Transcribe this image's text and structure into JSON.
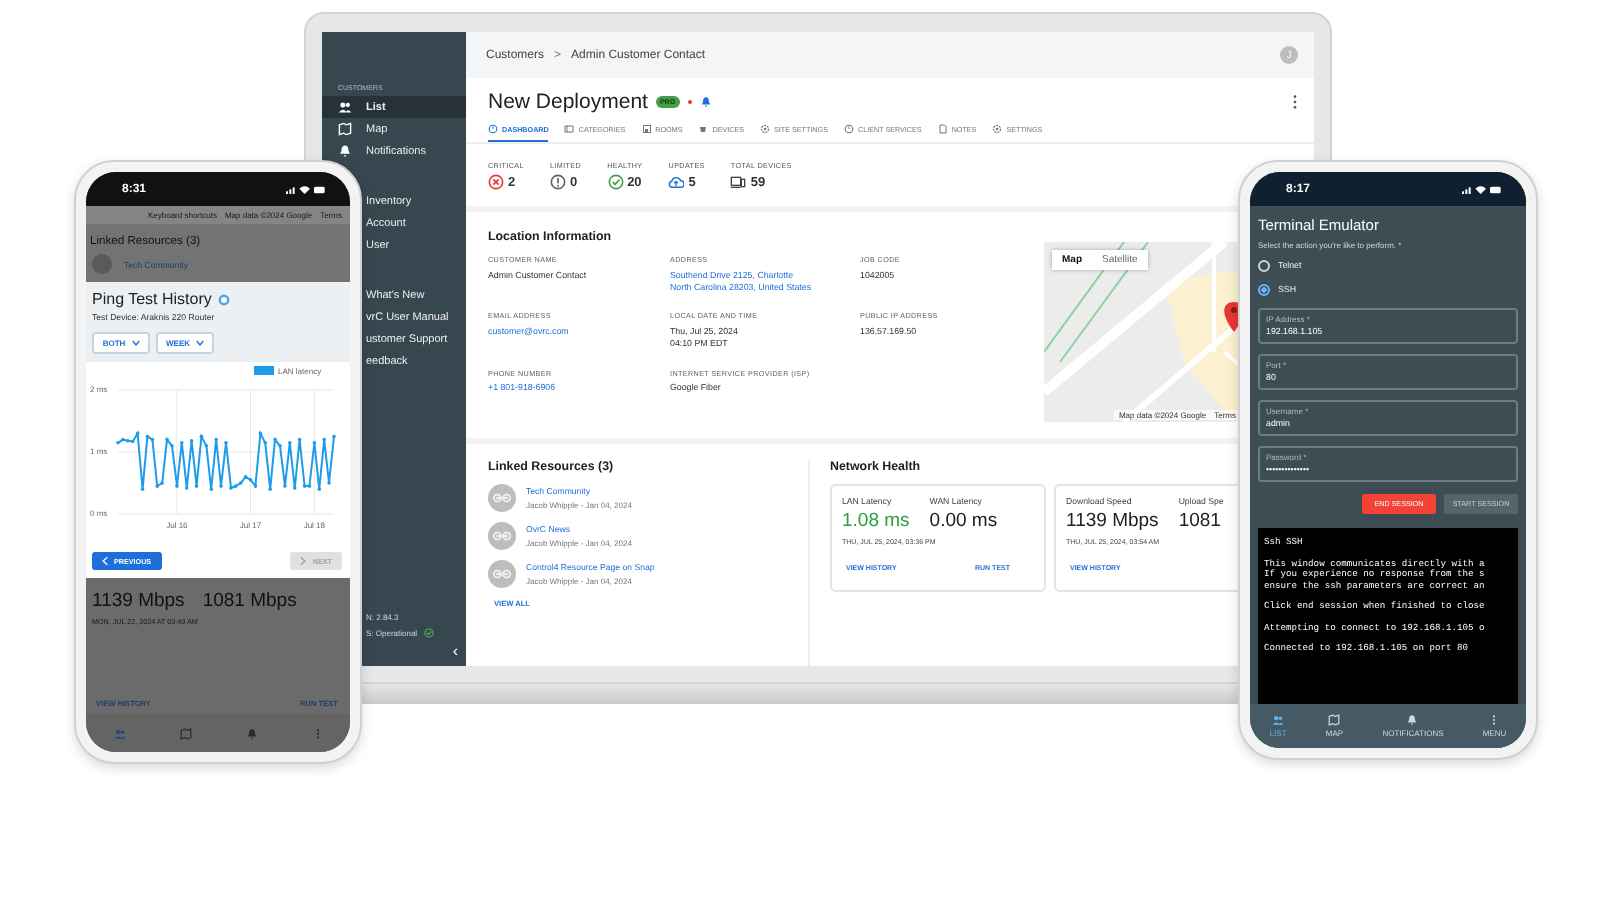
{
  "laptop": {
    "sidebar": {
      "groups": [
        {
          "label": "CUSTOMERS",
          "items": [
            {
              "label": "List",
              "selected": true
            },
            {
              "label": "Map",
              "selected": false
            },
            {
              "label": "Notifications",
              "selected": false
            }
          ]
        },
        {
          "items": [
            {
              "label": "Inventory",
              "selected": false
            },
            {
              "label": "Account",
              "selected": false
            },
            {
              "label": "User",
              "selected": false
            }
          ]
        },
        {
          "items": [
            {
              "label": "What's New",
              "selected": false
            },
            {
              "label": "vrC User Manual",
              "selected": false
            },
            {
              "label": "ustomer Support",
              "selected": false
            },
            {
              "label": "eedback",
              "selected": false
            }
          ]
        }
      ],
      "version": "N: 2.84.3",
      "status": "S: Operational",
      "collapse": "‹"
    },
    "breadcrumbs": [
      "Customers",
      "Admin Customer Contact"
    ],
    "breadcrumb_separator": ">",
    "avatar": "J",
    "title": "New Deployment",
    "badge": "PRO",
    "alert_dot": true,
    "tabs": [
      {
        "label": "DASHBOARD",
        "selected": true
      },
      {
        "label": "CATEGORIES",
        "selected": false
      },
      {
        "label": "ROOMS",
        "selected": false
      },
      {
        "label": "DEVICES",
        "selected": false
      },
      {
        "label": "SITE SETTINGS",
        "selected": false
      },
      {
        "label": "CLIENT SERVICES",
        "selected": false
      },
      {
        "label": "NOTES",
        "selected": false
      },
      {
        "label": "SETTINGS",
        "selected": false
      }
    ],
    "stats": [
      {
        "kind": "critical",
        "label": "CRITICAL",
        "value": "2"
      },
      {
        "kind": "limited",
        "label": "LIMITED",
        "value": "0"
      },
      {
        "kind": "healthy",
        "label": "HEALTHY",
        "value": "20"
      },
      {
        "kind": "updates",
        "label": "UPDATES",
        "value": "5"
      },
      {
        "kind": "total",
        "label": "TOTAL DEVICES",
        "value": "59"
      }
    ],
    "location": {
      "title": "Location Information",
      "fields": [
        {
          "label": "CUSTOMER NAME",
          "lines": [
            "Admin Customer Contact"
          ],
          "link": false
        },
        {
          "label": "ADDRESS",
          "lines": [
            "Southend Drive 2125, Charlotte",
            "North Carolina 28203, United States"
          ],
          "link": true
        },
        {
          "label": "JOB CODE",
          "lines": [
            "1042005"
          ],
          "link": false
        },
        {
          "label": "EMAIL ADDRESS",
          "lines": [
            "customer@ovrc.com"
          ],
          "link": true
        },
        {
          "label": "LOCAL DATE AND TIME",
          "lines": [
            "Thu, Jul 25, 2024",
            "04:10 PM EDT"
          ],
          "link": false
        },
        {
          "label": "PUBLIC IP ADDRESS",
          "lines": [
            "136.57.169.50"
          ],
          "link": false
        },
        {
          "label": "PHONE NUMBER",
          "lines": [
            "+1 801-918-6906"
          ],
          "link": true
        },
        {
          "label": "INTERNET SERVICE PROVIDER (ISP)",
          "lines": [
            "Google Fiber"
          ],
          "link": false
        }
      ],
      "map": {
        "toggles": [
          {
            "label": "Map",
            "selected": true
          },
          {
            "label": "Satellite",
            "selected": false
          }
        ],
        "attribution": "Map data ©2024 Google",
        "terms": "Terms"
      }
    },
    "linked": {
      "title": "Linked Resources (3)",
      "items": [
        {
          "title": "Tech Community",
          "meta": "Jacob Whipple - Jan 04, 2024"
        },
        {
          "title": "OvrC News",
          "meta": "Jacob Whipple - Jan 04, 2024"
        },
        {
          "title": "Control4 Resource Page on Snap",
          "meta": "Jacob Whipple - Jan 04, 2024"
        }
      ],
      "view_all": "VIEW ALL"
    },
    "network": {
      "title": "Network Health",
      "cards": [
        {
          "metrics": [
            {
              "label": "LAN Latency",
              "value": "1.08 ms",
              "color": "#2e9d3c"
            },
            {
              "label": "WAN Latency",
              "value": "0.00 ms",
              "color": "#212121"
            }
          ],
          "date": "THU, JUL 25, 2024, 03:36 PM",
          "actions": [
            "VIEW HISTORY",
            "RUN TEST"
          ]
        },
        {
          "metrics": [
            {
              "label": "Download Speed",
              "value": "1139 Mbps",
              "color": "#212121"
            },
            {
              "label": "Upload Spe",
              "value": "1081",
              "color": "#212121"
            }
          ],
          "date": "THU, JUL 25, 2024, 03:54 AM",
          "actions": [
            "VIEW HISTORY"
          ]
        }
      ]
    }
  },
  "left_phone": {
    "time": "8:31",
    "background": {
      "map_texts": [
        "Keyboard shortcuts",
        "Map data ©2024 Google",
        "Terms"
      ],
      "title": "Linked Resources (3)",
      "item": "Tech Community"
    },
    "modal": {
      "title": "Ping Test History",
      "subtitle": "Test Device: Araknis 220 Router",
      "filters": [
        "BOTH",
        "WEEK"
      ],
      "chart_data": {
        "type": "line",
        "series": [
          {
            "name": "LAN latency",
            "color": "#1e9be9",
            "values": [
              1.15,
              1.2,
              1.18,
              1.17,
              1.3,
              0.4,
              1.25,
              1.2,
              0.45,
              0.5,
              1.2,
              1.1,
              0.45,
              1.15,
              0.42,
              1.18,
              0.45,
              1.25,
              1.1,
              0.4,
              1.2,
              0.45,
              1.15,
              0.42,
              0.45,
              0.5,
              0.6,
              0.55,
              0.45,
              1.3,
              1.15,
              0.4,
              1.2,
              1.1,
              0.45,
              1.15,
              0.42,
              1.2,
              0.45,
              0.45,
              1.15,
              0.4,
              1.2,
              0.5,
              1.25
            ]
          }
        ],
        "categories": [
          null,
          null,
          null,
          null,
          null,
          null,
          null,
          null,
          null,
          null,
          null,
          null,
          "Jul 16",
          null,
          null,
          null,
          null,
          null,
          null,
          null,
          null,
          null,
          null,
          null,
          null,
          null,
          null,
          "Jul 17",
          null,
          null,
          null,
          null,
          null,
          null,
          null,
          null,
          null,
          null,
          null,
          null,
          "Jul 18",
          null,
          null,
          null,
          null
        ],
        "ylim": [
          0,
          2
        ],
        "yticks": [
          {
            "value": 0,
            "label": "0 ms"
          },
          {
            "value": 1,
            "label": "1 ms"
          },
          {
            "value": 2,
            "label": "2 ms"
          }
        ]
      },
      "buttons": [
        {
          "label": "PREVIOUS",
          "disabled": false
        },
        {
          "label": "NEXT",
          "disabled": true
        }
      ]
    },
    "bottom": {
      "values": [
        "1139 Mbps",
        "1081 Mbps"
      ],
      "date": "MON, JUL 22, 2024 AT 03:49 AM",
      "actions": [
        "VIEW HISTORY",
        "RUN TEST"
      ]
    }
  },
  "right_phone": {
    "time": "8:17",
    "title": "Terminal Emulator",
    "prompt": "Select the action you're like to perform. *",
    "options": [
      {
        "label": "Telnet",
        "selected": false
      },
      {
        "label": "SSH",
        "selected": true
      }
    ],
    "fields": [
      {
        "label": "IP Address *",
        "value": "192.168.1.105"
      },
      {
        "label": "Port *",
        "value": "80"
      },
      {
        "label": "Username *",
        "value": "admin"
      },
      {
        "label": "Password *",
        "value": "••••••••••••••"
      }
    ],
    "buttons": [
      {
        "label": "END SESSION",
        "disabled": false
      },
      {
        "label": "START SESSION",
        "disabled": true
      }
    ],
    "terminal": [
      [
        "Ssh SSH"
      ],
      [
        "This window communicates directly with a",
        "If you experience no response from the s",
        "ensure the ssh parameters are correct an"
      ],
      [
        "Click end session when finished to close"
      ],
      [
        "Attempting to connect to 192.168.1.105 o"
      ],
      [
        "Connected to 192.168.1.105 on port 80"
      ]
    ],
    "nav": [
      {
        "label": "LIST",
        "selected": true
      },
      {
        "label": "MAP",
        "selected": false
      },
      {
        "label": "NOTIFICATIONS",
        "selected": false
      },
      {
        "label": "MENU",
        "selected": false
      }
    ]
  }
}
